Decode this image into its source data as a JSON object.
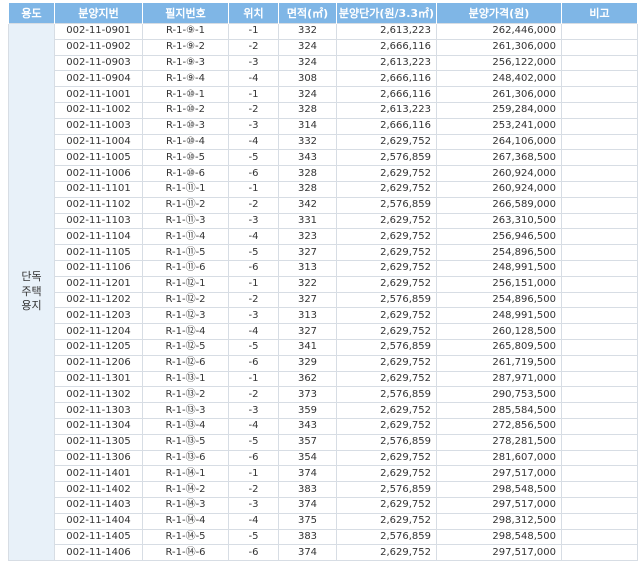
{
  "headers": {
    "use": "용도",
    "lot_no": "분양지번",
    "parcel_no": "필지번호",
    "position": "위치",
    "area": "면적(㎡)",
    "unit_price": "분양단가(원/3.3㎡)",
    "price": "분양가격(원)",
    "note": "비고"
  },
  "use_label": [
    "단독",
    "주택",
    "용지"
  ],
  "rows": [
    {
      "lot_no": "002-11-0901",
      "parcel_no": "R-1-⑨-1",
      "position": "-1",
      "area": "332",
      "unit_price": "2,613,223",
      "price": "262,446,000",
      "note": ""
    },
    {
      "lot_no": "002-11-0902",
      "parcel_no": "R-1-⑨-2",
      "position": "-2",
      "area": "324",
      "unit_price": "2,666,116",
      "price": "261,306,000",
      "note": ""
    },
    {
      "lot_no": "002-11-0903",
      "parcel_no": "R-1-⑨-3",
      "position": "-3",
      "area": "324",
      "unit_price": "2,613,223",
      "price": "256,122,000",
      "note": ""
    },
    {
      "lot_no": "002-11-0904",
      "parcel_no": "R-1-⑨-4",
      "position": "-4",
      "area": "308",
      "unit_price": "2,666,116",
      "price": "248,402,000",
      "note": ""
    },
    {
      "lot_no": "002-11-1001",
      "parcel_no": "R-1-⑩-1",
      "position": "-1",
      "area": "324",
      "unit_price": "2,666,116",
      "price": "261,306,000",
      "note": ""
    },
    {
      "lot_no": "002-11-1002",
      "parcel_no": "R-1-⑩-2",
      "position": "-2",
      "area": "328",
      "unit_price": "2,613,223",
      "price": "259,284,000",
      "note": ""
    },
    {
      "lot_no": "002-11-1003",
      "parcel_no": "R-1-⑩-3",
      "position": "-3",
      "area": "314",
      "unit_price": "2,666,116",
      "price": "253,241,000",
      "note": ""
    },
    {
      "lot_no": "002-11-1004",
      "parcel_no": "R-1-⑩-4",
      "position": "-4",
      "area": "332",
      "unit_price": "2,629,752",
      "price": "264,106,000",
      "note": ""
    },
    {
      "lot_no": "002-11-1005",
      "parcel_no": "R-1-⑩-5",
      "position": "-5",
      "area": "343",
      "unit_price": "2,576,859",
      "price": "267,368,500",
      "note": ""
    },
    {
      "lot_no": "002-11-1006",
      "parcel_no": "R-1-⑩-6",
      "position": "-6",
      "area": "328",
      "unit_price": "2,629,752",
      "price": "260,924,000",
      "note": ""
    },
    {
      "lot_no": "002-11-1101",
      "parcel_no": "R-1-⑪-1",
      "position": "-1",
      "area": "328",
      "unit_price": "2,629,752",
      "price": "260,924,000",
      "note": ""
    },
    {
      "lot_no": "002-11-1102",
      "parcel_no": "R-1-⑪-2",
      "position": "-2",
      "area": "342",
      "unit_price": "2,576,859",
      "price": "266,589,000",
      "note": ""
    },
    {
      "lot_no": "002-11-1103",
      "parcel_no": "R-1-⑪-3",
      "position": "-3",
      "area": "331",
      "unit_price": "2,629,752",
      "price": "263,310,500",
      "note": ""
    },
    {
      "lot_no": "002-11-1104",
      "parcel_no": "R-1-⑪-4",
      "position": "-4",
      "area": "323",
      "unit_price": "2,629,752",
      "price": "256,946,500",
      "note": ""
    },
    {
      "lot_no": "002-11-1105",
      "parcel_no": "R-1-⑪-5",
      "position": "-5",
      "area": "327",
      "unit_price": "2,629,752",
      "price": "254,896,500",
      "note": ""
    },
    {
      "lot_no": "002-11-1106",
      "parcel_no": "R-1-⑪-6",
      "position": "-6",
      "area": "313",
      "unit_price": "2,629,752",
      "price": "248,991,500",
      "note": ""
    },
    {
      "lot_no": "002-11-1201",
      "parcel_no": "R-1-⑫-1",
      "position": "-1",
      "area": "322",
      "unit_price": "2,629,752",
      "price": "256,151,000",
      "note": ""
    },
    {
      "lot_no": "002-11-1202",
      "parcel_no": "R-1-⑫-2",
      "position": "-2",
      "area": "327",
      "unit_price": "2,576,859",
      "price": "254,896,500",
      "note": ""
    },
    {
      "lot_no": "002-11-1203",
      "parcel_no": "R-1-⑫-3",
      "position": "-3",
      "area": "313",
      "unit_price": "2,629,752",
      "price": "248,991,500",
      "note": ""
    },
    {
      "lot_no": "002-11-1204",
      "parcel_no": "R-1-⑫-4",
      "position": "-4",
      "area": "327",
      "unit_price": "2,629,752",
      "price": "260,128,500",
      "note": ""
    },
    {
      "lot_no": "002-11-1205",
      "parcel_no": "R-1-⑫-5",
      "position": "-5",
      "area": "341",
      "unit_price": "2,576,859",
      "price": "265,809,500",
      "note": ""
    },
    {
      "lot_no": "002-11-1206",
      "parcel_no": "R-1-⑫-6",
      "position": "-6",
      "area": "329",
      "unit_price": "2,629,752",
      "price": "261,719,500",
      "note": ""
    },
    {
      "lot_no": "002-11-1301",
      "parcel_no": "R-1-⑬-1",
      "position": "-1",
      "area": "362",
      "unit_price": "2,629,752",
      "price": "287,971,000",
      "note": ""
    },
    {
      "lot_no": "002-11-1302",
      "parcel_no": "R-1-⑬-2",
      "position": "-2",
      "area": "373",
      "unit_price": "2,576,859",
      "price": "290,753,500",
      "note": ""
    },
    {
      "lot_no": "002-11-1303",
      "parcel_no": "R-1-⑬-3",
      "position": "-3",
      "area": "359",
      "unit_price": "2,629,752",
      "price": "285,584,500",
      "note": ""
    },
    {
      "lot_no": "002-11-1304",
      "parcel_no": "R-1-⑬-4",
      "position": "-4",
      "area": "343",
      "unit_price": "2,629,752",
      "price": "272,856,500",
      "note": ""
    },
    {
      "lot_no": "002-11-1305",
      "parcel_no": "R-1-⑬-5",
      "position": "-5",
      "area": "357",
      "unit_price": "2,576,859",
      "price": "278,281,500",
      "note": ""
    },
    {
      "lot_no": "002-11-1306",
      "parcel_no": "R-1-⑬-6",
      "position": "-6",
      "area": "354",
      "unit_price": "2,629,752",
      "price": "281,607,000",
      "note": ""
    },
    {
      "lot_no": "002-11-1401",
      "parcel_no": "R-1-⑭-1",
      "position": "-1",
      "area": "374",
      "unit_price": "2,629,752",
      "price": "297,517,000",
      "note": ""
    },
    {
      "lot_no": "002-11-1402",
      "parcel_no": "R-1-⑭-2",
      "position": "-2",
      "area": "383",
      "unit_price": "2,576,859",
      "price": "298,548,500",
      "note": ""
    },
    {
      "lot_no": "002-11-1403",
      "parcel_no": "R-1-⑭-3",
      "position": "-3",
      "area": "374",
      "unit_price": "2,629,752",
      "price": "297,517,000",
      "note": ""
    },
    {
      "lot_no": "002-11-1404",
      "parcel_no": "R-1-⑭-4",
      "position": "-4",
      "area": "375",
      "unit_price": "2,629,752",
      "price": "298,312,500",
      "note": ""
    },
    {
      "lot_no": "002-11-1405",
      "parcel_no": "R-1-⑭-5",
      "position": "-5",
      "area": "383",
      "unit_price": "2,576,859",
      "price": "298,548,500",
      "note": ""
    },
    {
      "lot_no": "002-11-1406",
      "parcel_no": "R-1-⑭-6",
      "position": "-6",
      "area": "374",
      "unit_price": "2,629,752",
      "price": "297,517,000",
      "note": ""
    }
  ]
}
